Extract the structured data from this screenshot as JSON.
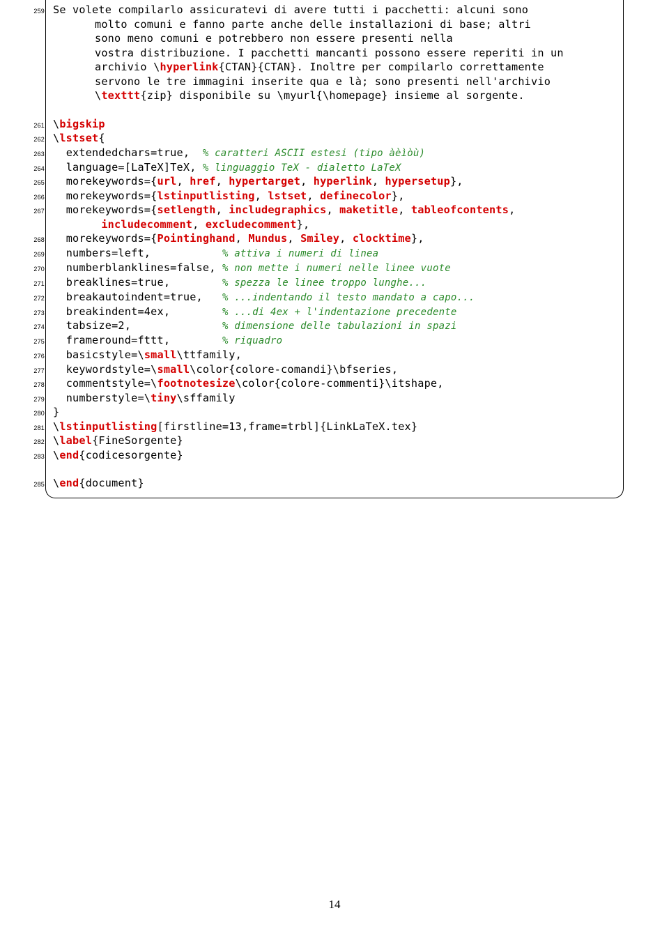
{
  "lines": [
    {
      "n": "259",
      "parts": [
        {
          "t": "Se volete compilarlo assicuratevi di avere tutti i pacchetti: alcuni sono"
        }
      ]
    },
    {
      "n": "",
      "wrap": true,
      "parts": [
        {
          "t": "molto comuni e fanno parte anche delle installazioni di base; altri"
        }
      ]
    },
    {
      "n": "",
      "wrap": true,
      "parts": [
        {
          "t": "sono meno comuni e potrebbero non essere presenti nella"
        }
      ]
    },
    {
      "n": "",
      "wrap": true,
      "parts": [
        {
          "t": "vostra distribuzione. I pacchetti mancanti possono essere reperiti in un"
        }
      ]
    },
    {
      "n": "",
      "wrap": true,
      "parts": [
        {
          "t": "archivio \\"
        },
        {
          "t": "hyperlink",
          "c": "cmd"
        },
        {
          "t": "{CTAN}{CTAN}. Inoltre per compilarlo correttamente"
        }
      ]
    },
    {
      "n": "",
      "wrap": true,
      "parts": [
        {
          "t": "servono le tre immagini inserite qua e là; sono presenti nell'archivio"
        }
      ]
    },
    {
      "n": "",
      "wrap": true,
      "parts": [
        {
          "t": "\\"
        },
        {
          "t": "texttt",
          "c": "cmd"
        },
        {
          "t": "{zip} disponibile su \\myurl{\\homepage} insieme al sorgente."
        }
      ]
    },
    {
      "blank": true
    },
    {
      "n": "261",
      "parts": [
        {
          "t": "\\"
        },
        {
          "t": "bigskip",
          "c": "cmd"
        }
      ]
    },
    {
      "n": "262",
      "parts": [
        {
          "t": "\\"
        },
        {
          "t": "lstset",
          "c": "cmd"
        },
        {
          "t": "{"
        }
      ]
    },
    {
      "n": "263",
      "parts": [
        {
          "t": "  extendedchars=true,  "
        },
        {
          "t": "% caratteri ASCII estesi (tipo àèìòù)",
          "c": "cmt"
        }
      ]
    },
    {
      "n": "264",
      "parts": [
        {
          "t": "  language=[LaTeX]TeX, "
        },
        {
          "t": "% linguaggio TeX - dialetto LaTeX",
          "c": "cmt"
        }
      ]
    },
    {
      "n": "265",
      "parts": [
        {
          "t": "  morekeywords={"
        },
        {
          "t": "url",
          "c": "kw"
        },
        {
          "t": ", "
        },
        {
          "t": "href",
          "c": "kw"
        },
        {
          "t": ", "
        },
        {
          "t": "hypertarget",
          "c": "kw"
        },
        {
          "t": ", "
        },
        {
          "t": "hyperlink",
          "c": "kw"
        },
        {
          "t": ", "
        },
        {
          "t": "hypersetup",
          "c": "kw"
        },
        {
          "t": "},"
        }
      ]
    },
    {
      "n": "266",
      "parts": [
        {
          "t": "  morekeywords={"
        },
        {
          "t": "lstinputlisting",
          "c": "kw"
        },
        {
          "t": ", "
        },
        {
          "t": "lstset",
          "c": "kw"
        },
        {
          "t": ", "
        },
        {
          "t": "definecolor",
          "c": "kw"
        },
        {
          "t": "},"
        }
      ]
    },
    {
      "n": "267",
      "parts": [
        {
          "t": "  morekeywords={"
        },
        {
          "t": "setlength",
          "c": "kw"
        },
        {
          "t": ", "
        },
        {
          "t": "includegraphics",
          "c": "kw"
        },
        {
          "t": ", "
        },
        {
          "t": "maketitle",
          "c": "kw"
        },
        {
          "t": ", "
        },
        {
          "t": "tableofcontents",
          "c": "kw"
        },
        {
          "t": ","
        }
      ]
    },
    {
      "n": "",
      "wrap": true,
      "parts": [
        {
          "t": " "
        },
        {
          "t": "includecomment",
          "c": "kw"
        },
        {
          "t": ", "
        },
        {
          "t": "excludecomment",
          "c": "kw"
        },
        {
          "t": "},"
        }
      ]
    },
    {
      "n": "268",
      "parts": [
        {
          "t": "  morekeywords={"
        },
        {
          "t": "Pointinghand",
          "c": "kw"
        },
        {
          "t": ", "
        },
        {
          "t": "Mundus",
          "c": "kw"
        },
        {
          "t": ", "
        },
        {
          "t": "Smiley",
          "c": "kw"
        },
        {
          "t": ", "
        },
        {
          "t": "clocktime",
          "c": "kw"
        },
        {
          "t": "},"
        }
      ]
    },
    {
      "n": "269",
      "parts": [
        {
          "t": "  numbers=left,           "
        },
        {
          "t": "% attiva i numeri di linea",
          "c": "cmt"
        }
      ]
    },
    {
      "n": "270",
      "parts": [
        {
          "t": "  numberblanklines=false, "
        },
        {
          "t": "% non mette i numeri nelle linee vuote",
          "c": "cmt"
        }
      ]
    },
    {
      "n": "271",
      "parts": [
        {
          "t": "  breaklines=true,        "
        },
        {
          "t": "% spezza le linee troppo lunghe...",
          "c": "cmt"
        }
      ]
    },
    {
      "n": "272",
      "parts": [
        {
          "t": "  breakautoindent=true,   "
        },
        {
          "t": "% ...indentando il testo mandato a capo...",
          "c": "cmt"
        }
      ]
    },
    {
      "n": "273",
      "parts": [
        {
          "t": "  breakindent=4ex,        "
        },
        {
          "t": "% ...di 4ex + l'indentazione precedente",
          "c": "cmt"
        }
      ]
    },
    {
      "n": "274",
      "parts": [
        {
          "t": "  tabsize=2,              "
        },
        {
          "t": "% dimensione delle tabulazioni in spazi",
          "c": "cmt"
        }
      ]
    },
    {
      "n": "275",
      "parts": [
        {
          "t": "  frameround=fttt,        "
        },
        {
          "t": "% riquadro",
          "c": "cmt"
        }
      ]
    },
    {
      "n": "276",
      "parts": [
        {
          "t": "  basicstyle=\\"
        },
        {
          "t": "small",
          "c": "cmd"
        },
        {
          "t": "\\ttfamily,"
        }
      ]
    },
    {
      "n": "277",
      "parts": [
        {
          "t": "  keywordstyle=\\"
        },
        {
          "t": "small",
          "c": "cmd"
        },
        {
          "t": "\\color{colore-comandi}\\bfseries,"
        }
      ]
    },
    {
      "n": "278",
      "parts": [
        {
          "t": "  commentstyle=\\"
        },
        {
          "t": "footnotesize",
          "c": "cmd"
        },
        {
          "t": "\\color{colore-commenti}\\itshape,"
        }
      ]
    },
    {
      "n": "279",
      "parts": [
        {
          "t": "  numberstyle=\\"
        },
        {
          "t": "tiny",
          "c": "cmd"
        },
        {
          "t": "\\sffamily"
        }
      ]
    },
    {
      "n": "280",
      "parts": [
        {
          "t": "}"
        }
      ]
    },
    {
      "n": "281",
      "parts": [
        {
          "t": "\\"
        },
        {
          "t": "lstinputlisting",
          "c": "cmd"
        },
        {
          "t": "[firstline=13,frame=trbl]{LinkLaTeX.tex}"
        }
      ]
    },
    {
      "n": "282",
      "parts": [
        {
          "t": "\\"
        },
        {
          "t": "label",
          "c": "cmd"
        },
        {
          "t": "{FineSorgente}"
        }
      ]
    },
    {
      "n": "283",
      "parts": [
        {
          "t": "\\"
        },
        {
          "t": "end",
          "c": "cmd"
        },
        {
          "t": "{codicesorgente}"
        }
      ]
    },
    {
      "blank": true
    },
    {
      "n": "285",
      "parts": [
        {
          "t": "\\"
        },
        {
          "t": "end",
          "c": "cmd"
        },
        {
          "t": "{document}"
        }
      ]
    }
  ],
  "pageNumber": "14"
}
